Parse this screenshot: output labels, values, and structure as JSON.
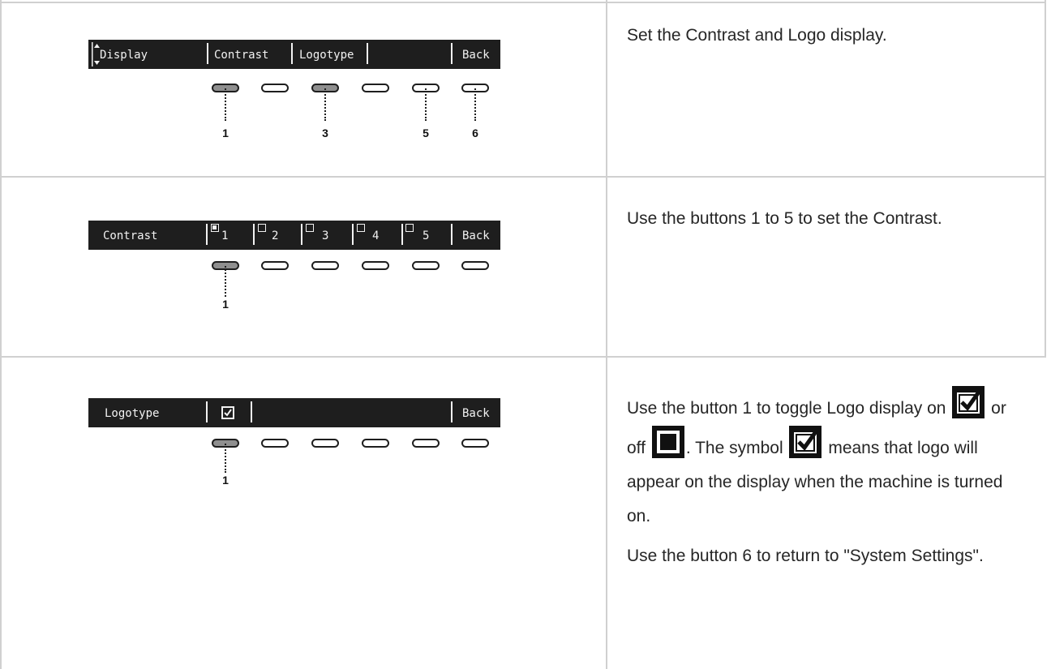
{
  "rows": [
    {
      "lcd": {
        "title": "Display",
        "items": [
          "Contrast",
          "Logotype"
        ],
        "back": "Back"
      },
      "callouts": [
        "1",
        "3",
        "5",
        "6"
      ],
      "description": "Set the Contrast and Logo display."
    },
    {
      "lcd": {
        "title": "Contrast",
        "items": [
          "1",
          "2",
          "3",
          "4",
          "5"
        ],
        "back": "Back"
      },
      "callouts": [
        "1"
      ],
      "description": "Use the buttons 1 to 5 to set the Contrast."
    },
    {
      "lcd": {
        "title": "Logotype",
        "back": "Back"
      },
      "callouts": [
        "1"
      ],
      "description": {
        "p1_part1": "Use the button 1 to toggle Logo display on",
        "p1_part2": "or off",
        "p1_part3": ". The symbol",
        "p1_part4": "means that logo will appear on the display when the machine is turned on.",
        "p2": "Use the button 6 to return to \"System Settings\"."
      }
    }
  ],
  "icons": {
    "arrows": "up-down-arrows-icon",
    "checked": "checked-box-icon",
    "unchecked": "empty-box-icon"
  },
  "colors": {
    "lcd_background": "#1e1e1e",
    "lcd_text": "#f2f2f2",
    "pressed_button": "#8f8f8f",
    "grid_lines": "#d0d0d0"
  }
}
